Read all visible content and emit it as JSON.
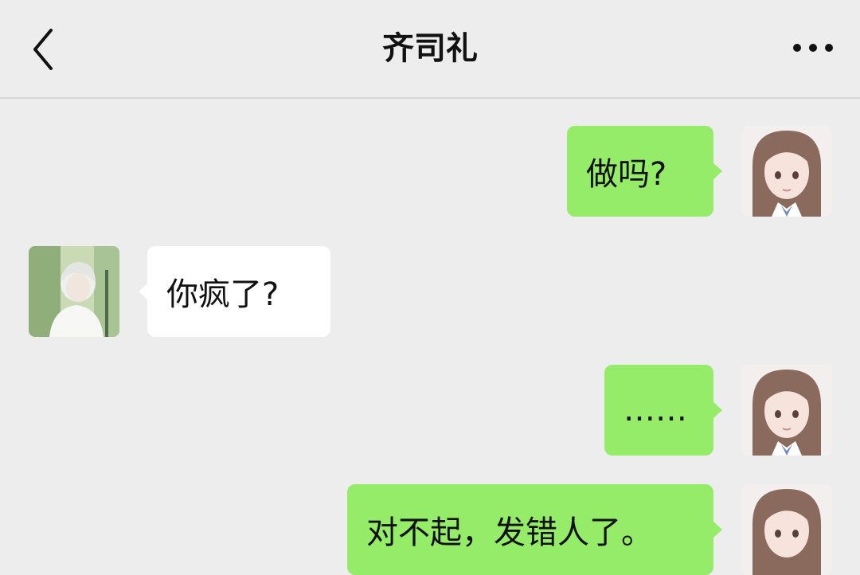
{
  "header": {
    "title": "齐司礼",
    "back_icon": "chevron-left-icon",
    "more_icon": "more-dots-icon"
  },
  "messages": [
    {
      "sender": "me",
      "text": "做吗?"
    },
    {
      "sender": "contact",
      "text": "你疯了?"
    },
    {
      "sender": "me",
      "text": "……"
    },
    {
      "sender": "me",
      "text": "对不起，发错人了。"
    }
  ],
  "colors": {
    "background": "#ededed",
    "my_bubble": "#95ec69",
    "their_bubble": "#ffffff"
  }
}
